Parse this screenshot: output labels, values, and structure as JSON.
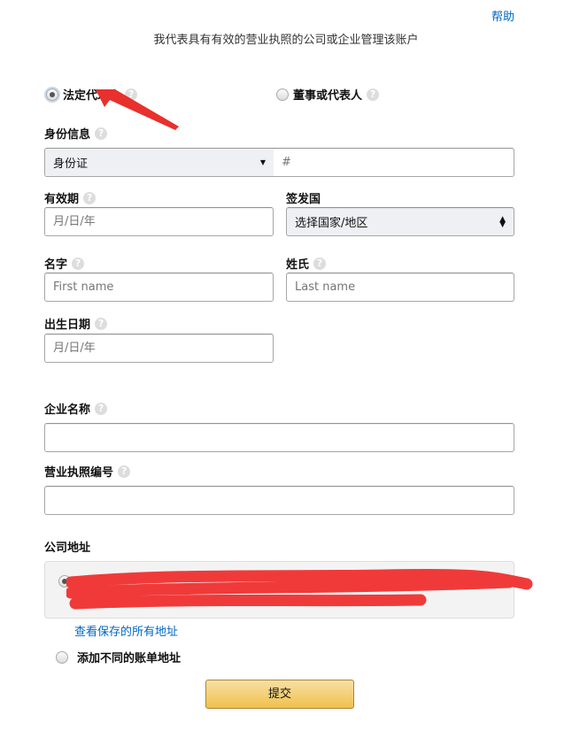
{
  "header": {
    "help_link": "帮助",
    "subtitle": "我代表具有有效的营业执照的公司或企业管理该账户"
  },
  "role": {
    "options": [
      {
        "label": "法定代理人",
        "selected": true
      },
      {
        "label": "董事或代表人",
        "selected": false
      }
    ]
  },
  "identity": {
    "label": "身份信息",
    "id_type": "身份证",
    "id_number_placeholder": "#"
  },
  "expiry": {
    "label": "有效期",
    "placeholder": "月/日/年"
  },
  "issuing_country": {
    "label": "签发国",
    "value": "选择国家/地区"
  },
  "first_name": {
    "label": "名字",
    "placeholder": "First name"
  },
  "last_name": {
    "label": "姓氏",
    "placeholder": "Last name"
  },
  "birth_date": {
    "label": "出生日期",
    "placeholder": "月/日/年"
  },
  "company_name": {
    "label": "企业名称",
    "value": ""
  },
  "license_number": {
    "label": "营业执照编号",
    "value": ""
  },
  "company_address": {
    "label": "公司地址",
    "view_all_link": "查看保存的所有地址",
    "add_different": "添加不同的账单地址"
  },
  "submit": {
    "label": "提交"
  },
  "colors": {
    "link": "#0066c0",
    "button": "#f0c14b",
    "annotation": "#e8302c"
  }
}
